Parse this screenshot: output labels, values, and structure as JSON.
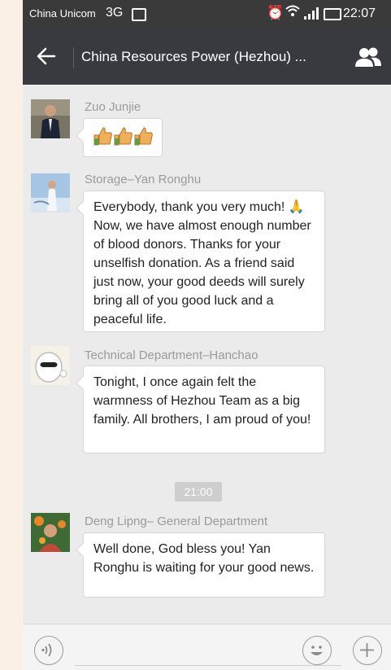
{
  "status_bar": {
    "carrier": "China Unicom",
    "network": "3G",
    "time": "22:07"
  },
  "header": {
    "title": "China Resources Power (Hezhou) ..."
  },
  "messages": [
    {
      "sender": "Zuo Junjie",
      "content_icon": "thumbs-up-emoji x3"
    },
    {
      "sender": "Storage–Yan Ronghu",
      "text": "Everybody, thank you very much! 🙏 Now, we have almost enough number of blood donors. Thanks for your unselfish donation. As a friend said just now, your good deeds will surely bring all of you good luck and a peaceful life."
    },
    {
      "sender": "Technical Department–Hanchao",
      "text": "Tonight, I once again felt the warmness of Hezhou Team as a big family. All brothers, I am proud of you!"
    },
    {
      "sender": "Deng Lipng– General Department",
      "text": "Well done, God bless you! Yan Ronghu is waiting for your good news."
    }
  ],
  "timestamp": "21:00",
  "colors": {
    "header_bg": "#393a3f",
    "chat_bg": "#ebebeb",
    "bubble_bg": "#ffffff"
  }
}
